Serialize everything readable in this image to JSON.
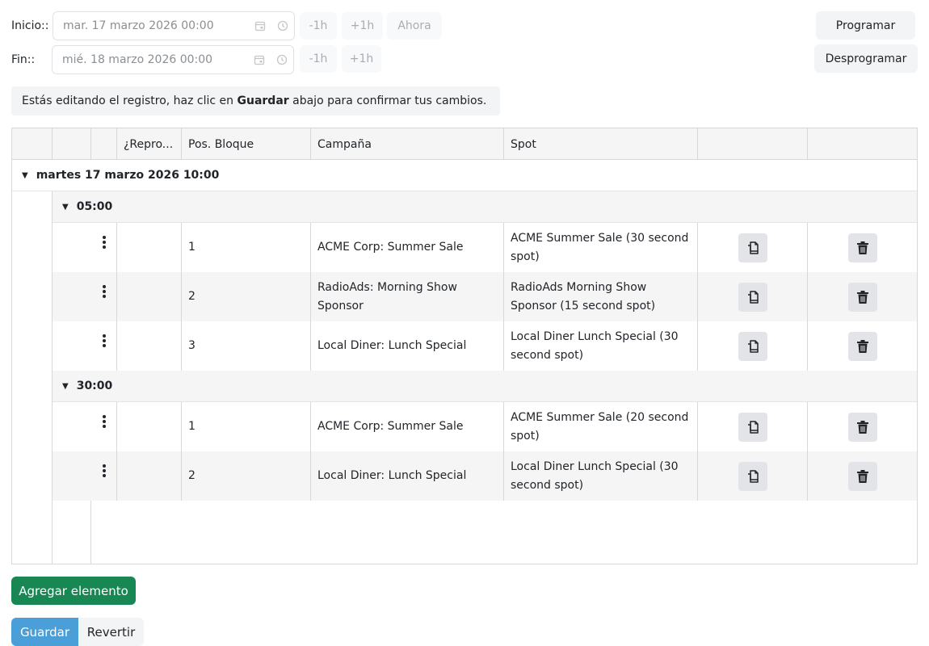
{
  "filters": {
    "start_label": "Inicio::",
    "start_value": "mar. 17 marzo 2026 00:00",
    "end_label": "Fin::",
    "end_value": "mié. 18 marzo 2026 00:00",
    "minus_label": "-1h",
    "plus_label": "+1h",
    "now_label": "Ahora"
  },
  "actions": {
    "schedule_label": "Programar",
    "unschedule_label": "Desprogramar"
  },
  "notice": {
    "prefix": "Estás editando el registro, haz clic en ",
    "bold": "Guardar",
    "suffix": " abajo para confirmar tus cambios."
  },
  "table": {
    "columns": [
      "",
      "",
      "",
      "¿Repro...",
      "Pos. Bloque",
      "Campaña",
      "Spot",
      "",
      ""
    ],
    "group_label": "martes 17 marzo 2026 10:00",
    "subgroups": [
      {
        "label": "05:00",
        "rows": [
          {
            "pos": "1",
            "campaign": "ACME Corp: Summer Sale",
            "spot": "ACME Summer Sale (30 second spot)"
          },
          {
            "pos": "2",
            "campaign": "RadioAds: Morning Show Sponsor",
            "spot": "RadioAds Morning Show Sponsor (15 second spot)"
          },
          {
            "pos": "3",
            "campaign": "Local Diner: Lunch Special",
            "spot": "Local Diner Lunch Special (30 second spot)"
          }
        ]
      },
      {
        "label": "30:00",
        "rows": [
          {
            "pos": "1",
            "campaign": "ACME Corp: Summer Sale",
            "spot": "ACME Summer Sale (20 second spot)"
          },
          {
            "pos": "2",
            "campaign": "Local Diner: Lunch Special",
            "spot": "Local Diner Lunch Special (30 second spot)"
          }
        ]
      }
    ]
  },
  "footer": {
    "add_label": "Agregar elemento",
    "save_label": "Guardar",
    "revert_label": "Revertir"
  },
  "colors": {
    "add_button": "#198754",
    "save_button": "#4a9fd8",
    "alt_row": "#f5f5f5"
  },
  "icons": {
    "calendar": "calendar-icon",
    "clock": "clock-icon",
    "copy": "copy-icon",
    "trash": "trash-icon",
    "drag": "kebab-icon",
    "caret": "caret-down-icon"
  }
}
